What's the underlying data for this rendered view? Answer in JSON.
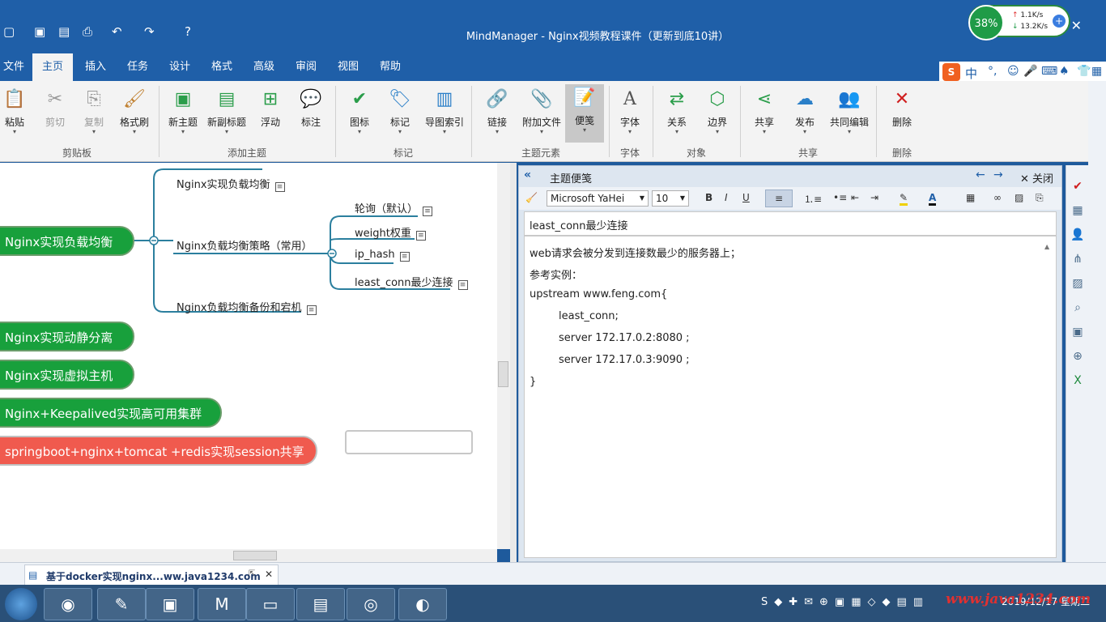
{
  "window": {
    "title": "MindManager - Nginx视频教程课件（更新到底10讲）"
  },
  "monitor": {
    "percent": "38%",
    "upload": "1.1K/s",
    "download": "13.2K/s"
  },
  "tabs": [
    "文件",
    "主页",
    "插入",
    "任务",
    "设计",
    "格式",
    "高级",
    "审阅",
    "视图",
    "帮助"
  ],
  "active_tab": "主页",
  "ribbon": {
    "buttons": [
      "粘贴",
      "剪切",
      "复制",
      "格式刷",
      "新主题",
      "新副标题",
      "浮动",
      "标注",
      "图标",
      "标记",
      "导图索引",
      "链接",
      "附加文件",
      "便笺",
      "字体",
      "关系",
      "边界",
      "共享",
      "发布",
      "共同编辑",
      "删除"
    ],
    "groups": [
      "剪贴板",
      "添加主题",
      "标记",
      "主题元素",
      "字体",
      "对象",
      "共享",
      "删除"
    ]
  },
  "ime": {
    "lang": "中"
  },
  "map": {
    "main_nodes": [
      "Nginx实现负载均衡",
      "Nginx实现动静分离",
      "Nginx实现虚拟主机",
      "Nginx+Keepalived实现高可用集群",
      "springboot+nginx+tomcat +redis实现session共享"
    ],
    "subtopics": [
      "Nginx实现负载均衡",
      "Nginx负载均衡策略（常用）",
      "Nginx负载均衡备份和宕机"
    ],
    "strategies": [
      "轮询（默认）",
      "weight权重",
      "ip_hash",
      "least_conn最少连接"
    ]
  },
  "notes": {
    "header": "主题便笺",
    "close": "关闭",
    "font": "Microsoft YaHei",
    "size": "10",
    "title": "least_conn最少连接",
    "lines": [
      "web请求会被分发到连接数最少的服务器上；",
      "参考实例：",
      " upstream www.feng.com{",
      "least_conn;",
      "server 172.17.0.2:8080 ;",
      "server 172.17.0.3:9090 ;",
      "}"
    ]
  },
  "doc_tab": {
    "label": "基于docker实现nginx...ww.java1234.com"
  },
  "taskbar": {
    "date": "2019/12/17 星期二"
  },
  "watermark": "www.java1234.com",
  "colors": {
    "titlebar": "#1f5fa8",
    "node_green": "#18a03c",
    "node_red": "#f05a4e",
    "ribbon_bg": "#f3f3f3"
  }
}
